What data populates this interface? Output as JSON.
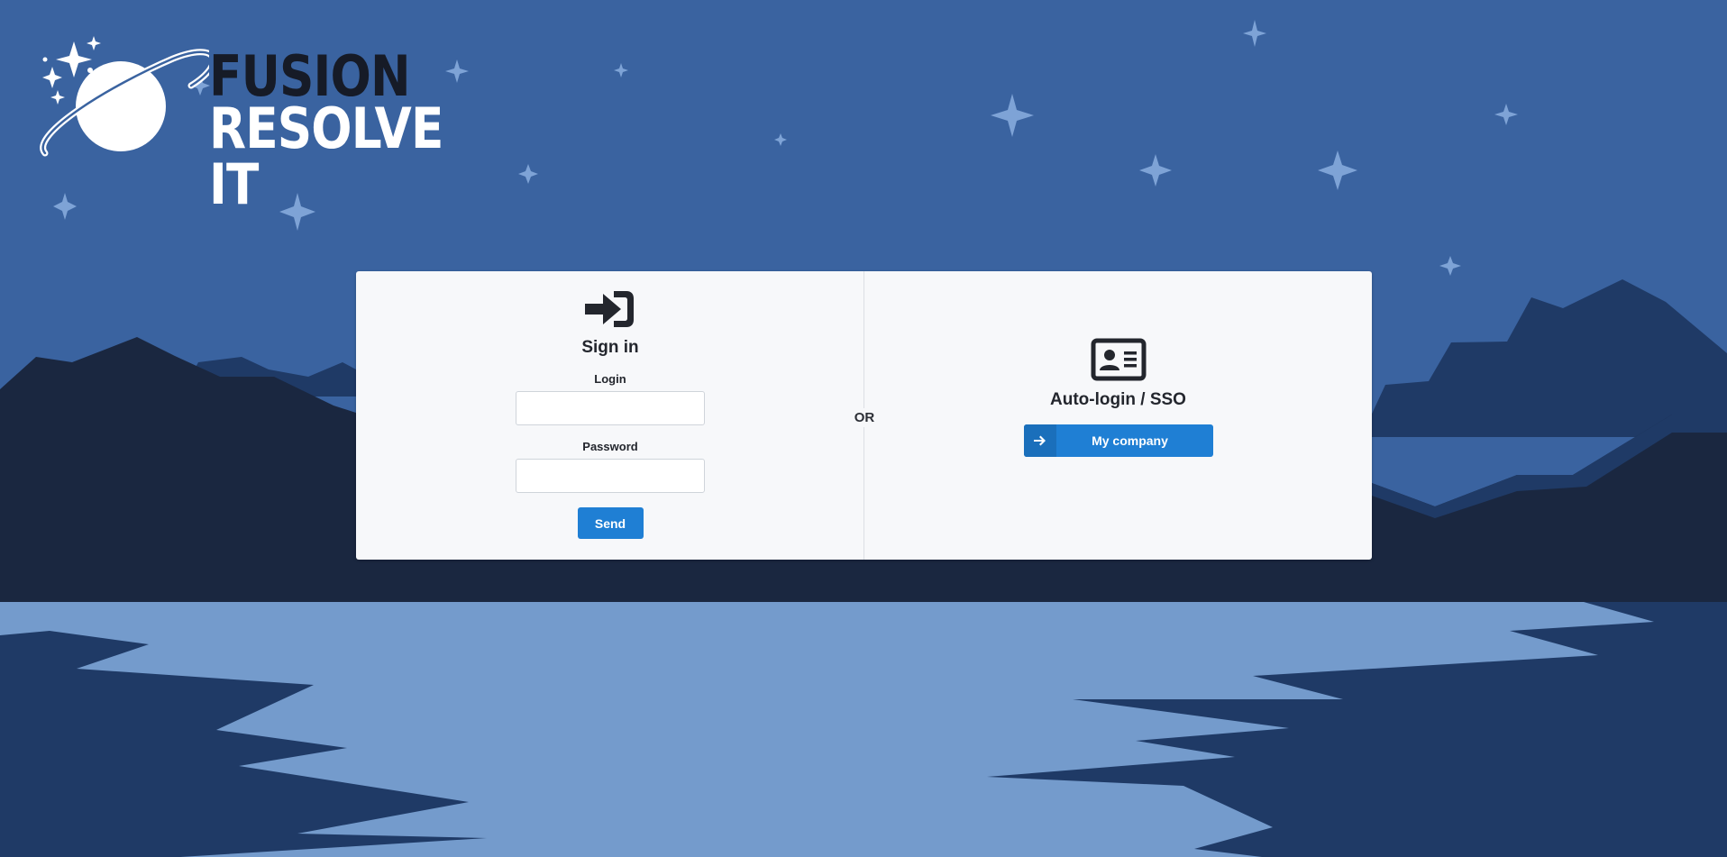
{
  "brand": {
    "line1": "FUSION",
    "line2": "RESOLVE IT"
  },
  "signin": {
    "icon": "sign-in-icon",
    "title": "Sign in",
    "login_label": "Login",
    "login_value": "",
    "password_label": "Password",
    "password_value": "",
    "send_label": "Send"
  },
  "separator": {
    "label": "OR"
  },
  "sso": {
    "icon": "id-card-icon",
    "title": "Auto-login / SSO",
    "button_icon": "arrow-right-icon",
    "button_label": "My company"
  },
  "colors": {
    "sky": "#3a63a0",
    "mountains_far": "#1f3a66",
    "mountains_near": "#1a2740",
    "water": "#749bcc",
    "accent": "#1f7fd4"
  }
}
